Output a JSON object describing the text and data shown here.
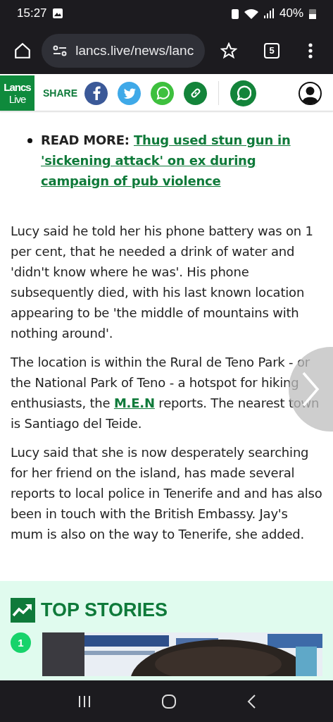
{
  "status_bar": {
    "time": "15:27",
    "battery": "40%"
  },
  "browser": {
    "url": "lancs.live/news/lanc",
    "tab_count": "5"
  },
  "site_header": {
    "logo": [
      "Lancs",
      "Live"
    ],
    "share_label": "SHARE"
  },
  "article": {
    "read_more": {
      "label": "READ MORE:",
      "link": "Thug used stun gun in 'sickening attack' on ex during campaign of pub violence"
    },
    "paragraphs": [
      [
        {
          "kind": "text",
          "text": "Lucy said he told her his phone battery was on 1 per cent, that he needed a drink of water and 'didn't know where he was'. His phone subsequently died, with his last known location appearing to be 'the middle of mountains with nothing around'."
        }
      ],
      [
        {
          "kind": "text",
          "text": "The location is within the Rural de Teno Park - or the National Park of Teno - a hotspot for hiking enthusiasts, the "
        },
        {
          "kind": "link",
          "text": "M.E.N"
        },
        {
          "kind": "text",
          "text": " reports. The nearest town is Santiago del Teide."
        }
      ],
      [
        {
          "kind": "text",
          "text": "Lucy said that she is now desperately searching for her friend on the island, has made several reports to local police in Tenerife and and has also been in touch with the British Embassy. Jay's mum is also on the way to Tenerife, she added."
        }
      ]
    ]
  },
  "top_stories": {
    "title": "TOP STORIES",
    "items": [
      {
        "rank": "1",
        "kind": "picture"
      }
    ]
  }
}
